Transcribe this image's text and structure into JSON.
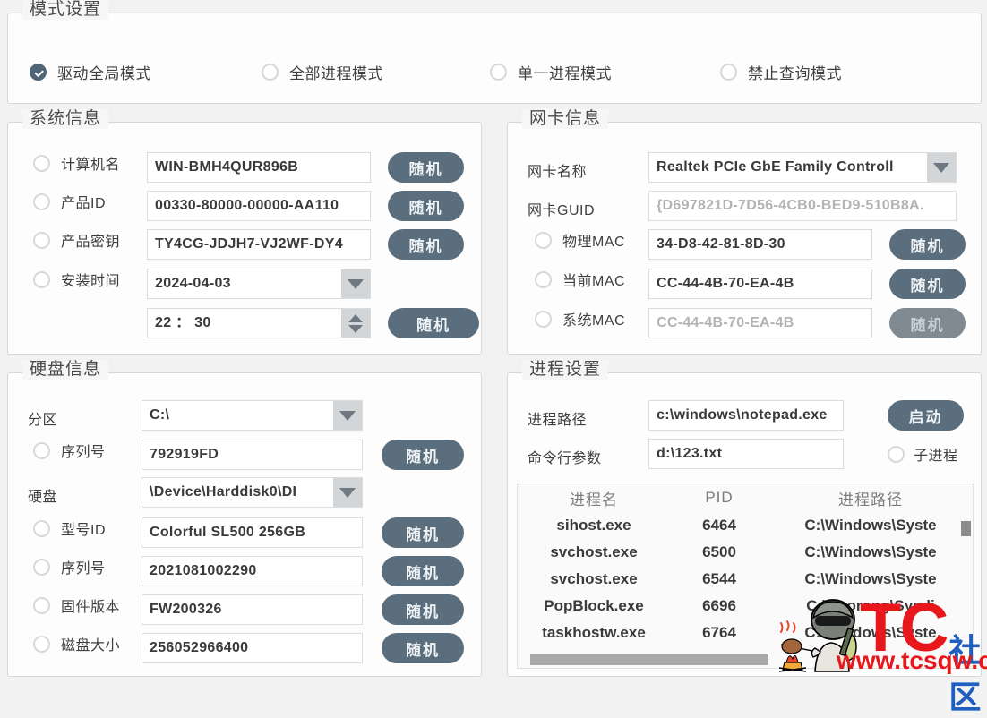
{
  "mode_panel": {
    "legend": "模式设置",
    "options": [
      {
        "label": "驱动全局模式",
        "checked": true
      },
      {
        "label": "全部进程模式",
        "checked": false
      },
      {
        "label": "单一进程模式",
        "checked": false
      },
      {
        "label": "禁止查询模式",
        "checked": false
      }
    ]
  },
  "system_panel": {
    "legend": "系统信息",
    "rows": [
      {
        "label": "计算机名",
        "value": "WIN-BMH4QUR896B",
        "button": "随机"
      },
      {
        "label": "产品ID",
        "value": "00330-80000-00000-AA110",
        "button": "随机"
      },
      {
        "label": "产品密钥",
        "value": "TY4CG-JDJH7-VJ2WF-DY4",
        "button": "随机"
      },
      {
        "label": "安装时间",
        "value": "2024-04-03"
      }
    ],
    "time_value": "22 ： 30",
    "time_button": "随机"
  },
  "nic_panel": {
    "legend": "网卡信息",
    "name_label": "网卡名称",
    "name_value": "Realtek PCIe GbE Family Controll",
    "guid_label": "网卡GUID",
    "guid_value": "{D697821D-7D56-4CB0-BED9-510B8A.",
    "rows": [
      {
        "label": "物理MAC",
        "value": "34-D8-42-81-8D-30",
        "button": "随机",
        "dim": false,
        "btn_disabled": false
      },
      {
        "label": "当前MAC",
        "value": "CC-44-4B-70-EA-4B",
        "button": "随机",
        "dim": false,
        "btn_disabled": false
      },
      {
        "label": "系统MAC",
        "value": "CC-44-4B-70-EA-4B",
        "button": "随机",
        "dim": true,
        "btn_disabled": true
      }
    ]
  },
  "disk_panel": {
    "legend": "硬盘信息",
    "partition_label": "分区",
    "partition_value": "C:\\",
    "serial_label": "序列号",
    "serial_value": "792919FD",
    "serial_button": "随机",
    "disk_label": "硬盘",
    "disk_value": "\\Device\\Harddisk0\\DI",
    "rows": [
      {
        "label": "型号ID",
        "value": "Colorful SL500 256GB",
        "button": "随机"
      },
      {
        "label": "序列号",
        "value": "2021081002290",
        "button": "随机"
      },
      {
        "label": "固件版本",
        "value": "FW200326",
        "button": "随机"
      },
      {
        "label": "磁盘大小",
        "value": "256052966400",
        "button": "随机"
      }
    ]
  },
  "process_panel": {
    "legend": "进程设置",
    "path_label": "进程路径",
    "path_value": "c:\\windows\\notepad.exe",
    "start_button": "启动",
    "args_label": "命令行参数",
    "args_value": "d:\\123.txt",
    "child_label": "子进程",
    "table": {
      "headers": {
        "name": "进程名",
        "pid": "PID",
        "path": "进程路径"
      },
      "rows": [
        {
          "name": "sihost.exe",
          "pid": "6464",
          "path": "C:\\Windows\\Syste"
        },
        {
          "name": "svchost.exe",
          "pid": "6500",
          "path": "C:\\Windows\\Syste"
        },
        {
          "name": "svchost.exe",
          "pid": "6544",
          "path": "C:\\Windows\\Syste"
        },
        {
          "name": "PopBlock.exe",
          "pid": "6696",
          "path": "C:\\Huorong\\Sysdi"
        },
        {
          "name": "taskhostw.exe",
          "pid": "6764",
          "path": "C:\\Windows\\Syste"
        }
      ]
    }
  },
  "watermark": {
    "tc_t": "T",
    "tc_c": "C",
    "community": "社区",
    "url": "www.tcsqw.com"
  },
  "colors": {
    "accent": "#5b6e7d",
    "checked_radio": "#4f6476",
    "watermark_red": "#e8171b",
    "watermark_blue": "#1f5fbf"
  }
}
